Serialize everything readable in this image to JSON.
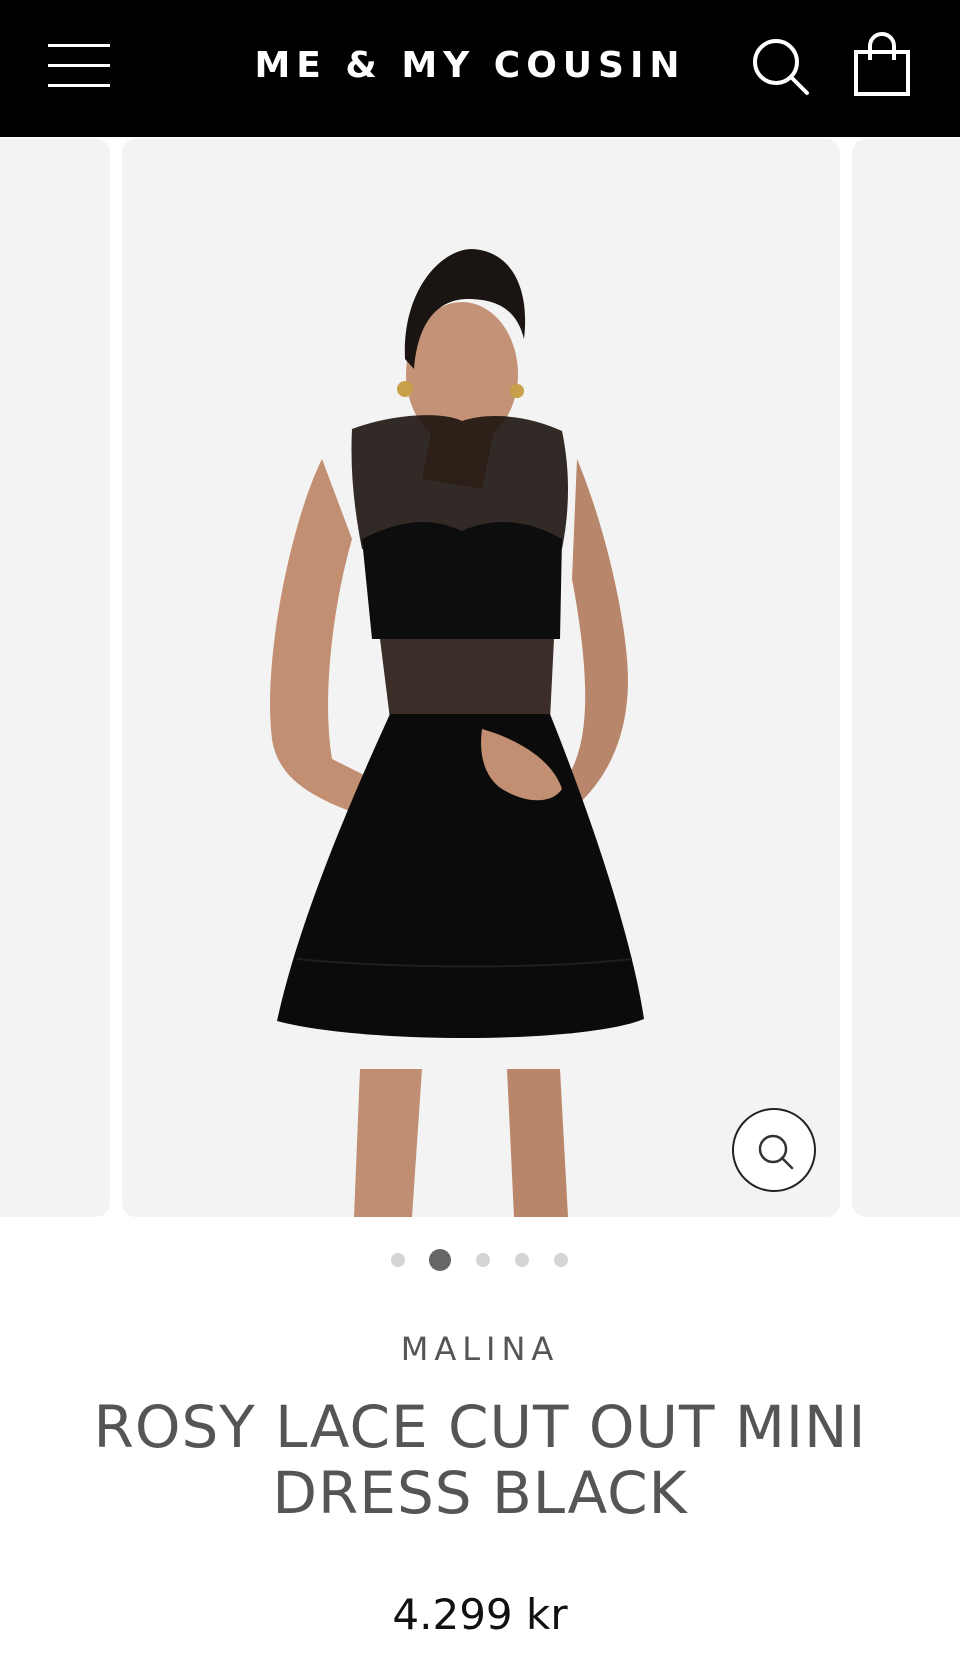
{
  "header": {
    "brand": "ME & MY COUSIN",
    "menu_icon": "hamburger-menu-icon",
    "search_icon": "search-icon",
    "cart_icon": "shopping-bag-icon",
    "background": "#000000"
  },
  "gallery": {
    "slide_count": 5,
    "active_index": 1,
    "zoom_icon": "zoom-search-icon"
  },
  "product": {
    "brand": "MALINA",
    "title": "ROSY LACE CUT OUT MINI DRESS BLACK",
    "price": "4.299 kr"
  },
  "colors": {
    "text_gray": "#555555",
    "slide_bg": "#f4f3f3",
    "dot_active": "#666666",
    "dot_inactive": "#d4d4d4"
  }
}
